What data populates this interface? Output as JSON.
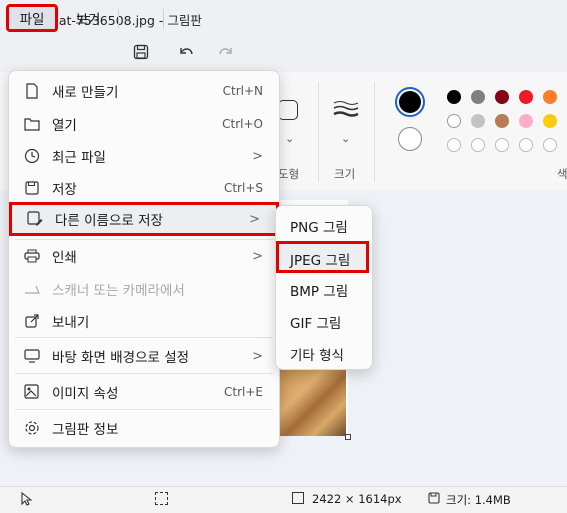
{
  "window": {
    "title": "cat-7536508.jpg - 그림판"
  },
  "menubar": {
    "file": "파일",
    "view": "보기"
  },
  "ribbon": {
    "shapes_label": "도형",
    "size_label": "크기",
    "colors_label": "색"
  },
  "file_menu": {
    "items": [
      {
        "label": "새로 만들기",
        "shortcut": "Ctrl+N"
      },
      {
        "label": "열기",
        "shortcut": "Ctrl+O"
      },
      {
        "label": "최근 파일",
        "shortcut": ">"
      },
      {
        "label": "저장",
        "shortcut": "Ctrl+S"
      },
      {
        "label": "다른 이름으로 저장",
        "shortcut": ">"
      },
      {
        "label": "인쇄",
        "shortcut": ">"
      },
      {
        "label": "스캐너 또는 카메라에서",
        "shortcut": ""
      },
      {
        "label": "보내기",
        "shortcut": ""
      },
      {
        "label": "바탕 화면 배경으로 설정",
        "shortcut": ">"
      },
      {
        "label": "이미지 속성",
        "shortcut": "Ctrl+E"
      },
      {
        "label": "그림판 정보",
        "shortcut": ""
      }
    ]
  },
  "save_as_menu": {
    "items": [
      "PNG 그림",
      "JPEG 그림",
      "BMP 그림",
      "GIF 그림",
      "기타 형식"
    ]
  },
  "statusbar": {
    "dimensions": "2422 × 1614px",
    "size": "크기: 1.4MB"
  },
  "colors": {
    "row1": [
      "#000000",
      "#7f7f7f",
      "#880015",
      "#ed1c24",
      "#ff7f27"
    ],
    "row2": [
      "#ffffff",
      "#c3c3c3",
      "#b97a57",
      "#ffaec9",
      "#ffc90e"
    ],
    "highlight": "#e00000"
  }
}
